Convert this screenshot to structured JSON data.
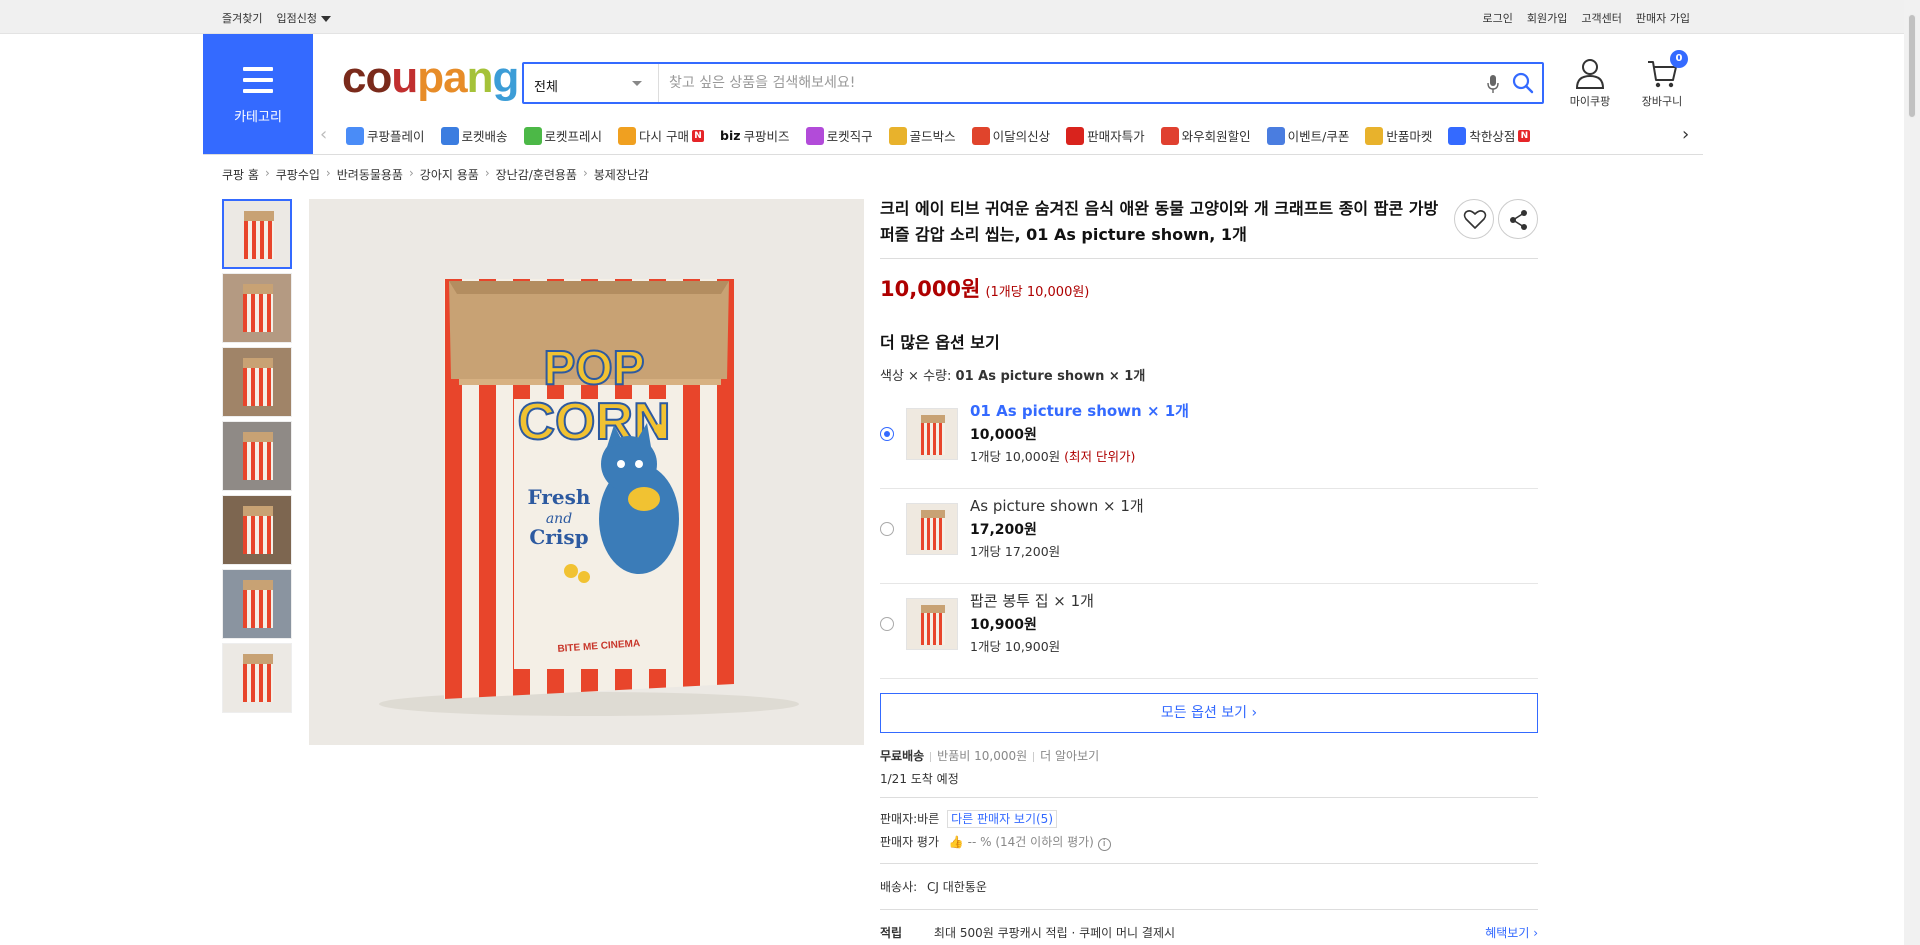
{
  "topbar": {
    "left": [
      "즐겨찾기",
      "입점신청"
    ],
    "right": [
      "로그인",
      "회원가입",
      "고객센터",
      "판매자 가입"
    ]
  },
  "header": {
    "category_label": "카테고리",
    "logo": [
      "c",
      "o",
      "u",
      "p",
      "a",
      "n",
      "g"
    ],
    "search_category": "전체",
    "search_placeholder": "찾고 싶은 상품을 검색해보세요!",
    "mycoupang": "마이쿠팡",
    "cart": "장바구니",
    "cart_count": "0"
  },
  "nav": [
    {
      "label": "쿠팡플레이",
      "icon": "play-icon",
      "color": "#4a8cf7"
    },
    {
      "label": "로켓배송",
      "icon": "rocket-icon",
      "color": "#3b7de0"
    },
    {
      "label": "로켓프레시",
      "icon": "rocket-fresh-icon",
      "color": "#4cb847"
    },
    {
      "label": "다시 구매",
      "icon": "repurchase-icon",
      "color": "#f0a020",
      "badge": "N"
    },
    {
      "label": "쿠팡비즈",
      "icon": "biz-icon",
      "prefix": "biz"
    },
    {
      "label": "로켓직구",
      "icon": "rocket-global-icon",
      "color": "#b24bd9"
    },
    {
      "label": "골드박스",
      "icon": "goldbox-icon",
      "color": "#e8b22c"
    },
    {
      "label": "이달의신상",
      "icon": "new-items-icon",
      "color": "#e0442c"
    },
    {
      "label": "판매자특가",
      "icon": "seller-deal-icon",
      "color": "#d9231d"
    },
    {
      "label": "와우회원할인",
      "icon": "wow-icon",
      "color": "#e04030"
    },
    {
      "label": "이벤트/쿠폰",
      "icon": "event-icon",
      "color": "#4a7de0"
    },
    {
      "label": "반품마켓",
      "icon": "return-market-icon",
      "color": "#e8b22c"
    },
    {
      "label": "착한상점",
      "icon": "good-store-icon",
      "color": "#346aff",
      "badge": "N"
    }
  ],
  "breadcrumb": [
    "쿠팡 홈",
    "쿠팡수입",
    "반려동물용품",
    "강아지 용품",
    "장난감/훈련용품",
    "봉제장난감"
  ],
  "product": {
    "title": "크리 에이 티브 귀여운 숨겨진 음식 애완 동물 고양이와 개 크래프트 종이 팝콘 가방 퍼즐 감압 소리 씹는, 01 As picture shown, 1개",
    "price": "10,000원",
    "unit_price": "(1개당 10,000원)",
    "more_options": "더 많은 옵션 보기",
    "option_summary_label": "색상 × 수량:",
    "option_summary_value": "01 As picture shown × 1개",
    "options": [
      {
        "name": "01 As picture shown × 1개",
        "price": "10,000원",
        "unit": "1개당 10,000원",
        "tag": "(최저 단위가)",
        "selected": true
      },
      {
        "name": "As picture shown × 1개",
        "price": "17,200원",
        "unit": "1개당 17,200원",
        "tag": "",
        "selected": false
      },
      {
        "name": "팝콘 봉투 집 × 1개",
        "price": "10,900원",
        "unit": "1개당 10,900원",
        "tag": "",
        "selected": false
      }
    ],
    "all_options": "모든 옵션 보기 ›",
    "shipping": {
      "free": "무료배송",
      "return_fee": "반품비 10,000원",
      "learn_more": "더 알아보기",
      "arrival": "1/21 도착 예정"
    },
    "seller": {
      "label": "판매자:",
      "name": "바른",
      "other_sellers": "다른 판매자 보기(5)",
      "rating_label": "판매자 평가",
      "rating": "-- %",
      "rating_note": "(14건 이하의 평가)"
    },
    "carrier": {
      "label": "배송사:",
      "name": "CJ 대한통운"
    },
    "benefit": {
      "label": "적립",
      "text": "최대 500원 쿠팡캐시 적립 · 쿠페이 머니 결제시",
      "link": "혜택보기 ›"
    }
  },
  "image": {
    "bag_top": "POP",
    "bag_bottom": "CORN",
    "fresh": "Fresh",
    "and": "and",
    "crisp": "Crisp",
    "footer": "BITE ME CINEMA"
  },
  "colors": {
    "accent": "#346aff",
    "price": "#ae0000"
  }
}
